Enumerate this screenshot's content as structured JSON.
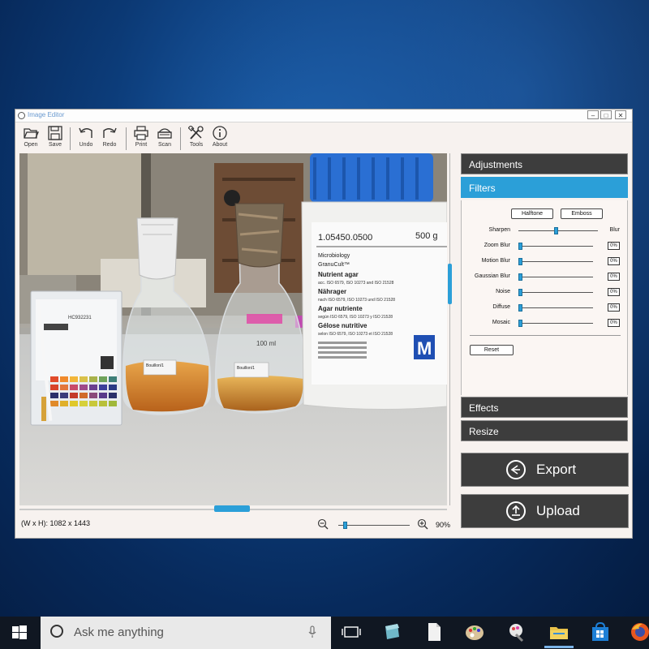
{
  "window": {
    "title": "Image Editor",
    "controls": {
      "minimize": "–",
      "maximize": "□",
      "close": "✕"
    }
  },
  "toolbar": {
    "items": [
      {
        "label": "Open",
        "icon": "folder-open-icon"
      },
      {
        "label": "Save",
        "icon": "floppy-disk-icon"
      },
      {
        "label": "Undo",
        "icon": "undo-icon"
      },
      {
        "label": "Redo",
        "icon": "redo-icon"
      },
      {
        "label": "Print",
        "icon": "printer-icon"
      },
      {
        "label": "Scan",
        "icon": "scanner-icon"
      },
      {
        "label": "Tools",
        "icon": "tools-icon"
      },
      {
        "label": "About",
        "icon": "info-icon"
      }
    ]
  },
  "photo": {
    "flask_label_1": "Bouillon/1",
    "flask_label_2": "Bouillon/1",
    "bottle_code": "1.05450.0500",
    "bottle_weight": "500 g",
    "bottle_line_1": "Microbiology",
    "bottle_line_2": "GranuCult™",
    "bottle_line_3": "Nutrient agar",
    "bottle_line_4": "acc. ISO 6579, ISO 10273 and ISO 21528",
    "bottle_line_5": "Nährager",
    "bottle_line_6": "nach ISO 6579, ISO 10273 und ISO 21528",
    "bottle_line_7": "Agar nutriente",
    "bottle_line_8": "según ISO 6579, ISO 10273 y ISO 21528",
    "bottle_line_9": "Gélose nutritive",
    "bottle_line_10": "selon ISO 6579, ISO 10273 et ISO 21528",
    "flask_volume": "100 ml",
    "strip_box_code": "HC932231"
  },
  "status": {
    "dimensions": "(W x H): 1082 x 1443",
    "zoom": "90%",
    "zoom_level": 0.1
  },
  "panel": {
    "adjustments": "Adjustments",
    "filters": "Filters",
    "effects": "Effects",
    "resize": "Resize",
    "halftone": "Halftone",
    "emboss": "Emboss",
    "sharpen": "Sharpen",
    "blur": "Blur",
    "sharpen_blur_level": 0.5,
    "sliders": [
      {
        "label": "Zoom Blur",
        "value": "0%"
      },
      {
        "label": "Motion Blur",
        "value": "0%"
      },
      {
        "label": "Gaussian Blur",
        "value": "0%"
      },
      {
        "label": "Noise",
        "value": "0%"
      },
      {
        "label": "Diffuse",
        "value": "0%"
      },
      {
        "label": "Mosaic",
        "value": "0%"
      }
    ],
    "reset": "Reset",
    "export": "Export",
    "upload": "Upload"
  },
  "taskbar": {
    "search_placeholder": "Ask me anything"
  },
  "colors": {
    "accent": "#2b9fd8",
    "panel_dark": "#3d3d3d",
    "window_bg": "#f7f2ef"
  }
}
